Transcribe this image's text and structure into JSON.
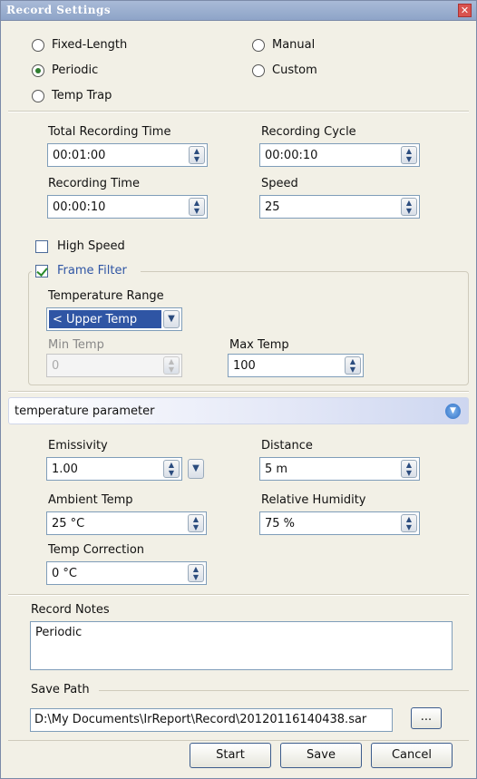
{
  "window": {
    "title": "Record Settings",
    "close_glyph": "✕"
  },
  "mode": {
    "fixed_length": "Fixed-Length",
    "manual": "Manual",
    "periodic": "Periodic",
    "custom": "Custom",
    "temp_trap": "Temp Trap",
    "selected": "Periodic"
  },
  "timing": {
    "total_recording_time_label": "Total Recording Time",
    "total_recording_time": "00:01:00",
    "recording_cycle_label": "Recording Cycle",
    "recording_cycle": "00:00:10",
    "recording_time_label": "Recording Time",
    "recording_time": "00:00:10",
    "speed_label": "Speed",
    "speed": "25"
  },
  "options": {
    "high_speed_label": "High Speed",
    "high_speed_checked": false,
    "frame_filter_label": "Frame Filter",
    "frame_filter_checked": true
  },
  "frame_filter": {
    "temperature_range_label": "Temperature Range",
    "temperature_range": "< Upper Temp",
    "min_temp_label": "Min Temp",
    "min_temp": "0",
    "max_temp_label": "Max Temp",
    "max_temp": "100"
  },
  "temperature_parameter": {
    "header": "temperature parameter",
    "emissivity_label": "Emissivity",
    "emissivity": "1.00",
    "distance_label": "Distance",
    "distance": "5 m",
    "ambient_temp_label": "Ambient Temp",
    "ambient_temp": "25 °C",
    "relative_humidity_label": "Relative Humidity",
    "relative_humidity": "75 %",
    "temp_correction_label": "Temp Correction",
    "temp_correction": "0 °C"
  },
  "notes": {
    "label": "Record Notes",
    "value": "Periodic"
  },
  "save_path": {
    "label": "Save Path",
    "value": "D:\\My Documents\\IrReport\\Record\\20120116140438.sar",
    "browse_label": "..."
  },
  "buttons": {
    "start": "Start",
    "save": "Save",
    "cancel": "Cancel"
  },
  "icons": {
    "spin": "▲▼",
    "dropdown": "▼",
    "collapse": "⌄"
  },
  "colors": {
    "accent": "#2f55a4",
    "titlebar": "#8ea4c8"
  }
}
